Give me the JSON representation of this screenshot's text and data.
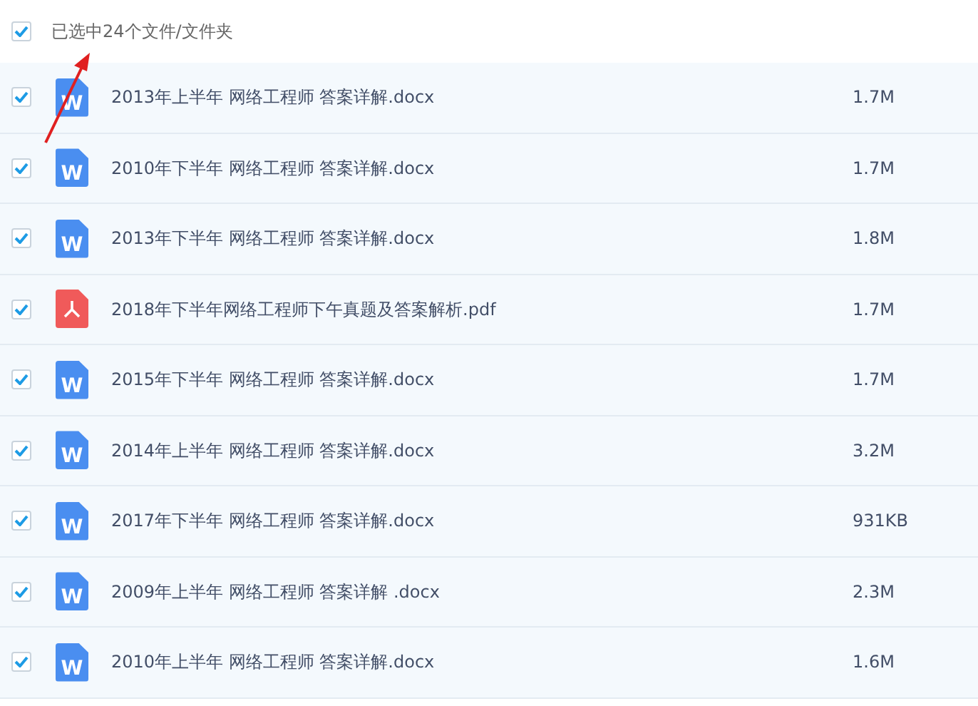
{
  "header": {
    "checked": true,
    "label": "已选中24个文件/文件夹"
  },
  "files": [
    {
      "kind": "word",
      "badge": "W",
      "name": "2013年上半年 网络工程师 答案详解.docx",
      "size": "1.7M",
      "checked": true
    },
    {
      "kind": "word",
      "badge": "W",
      "name": "2010年下半年 网络工程师 答案详解.docx",
      "size": "1.7M",
      "checked": true
    },
    {
      "kind": "word",
      "badge": "W",
      "name": "2013年下半年 网络工程师 答案详解.docx",
      "size": "1.8M",
      "checked": true
    },
    {
      "kind": "pdf",
      "name": "2018年下半年网络工程师下午真题及答案解析.pdf",
      "size": "1.7M",
      "checked": true
    },
    {
      "kind": "word",
      "badge": "W",
      "name": "2015年下半年 网络工程师 答案详解.docx",
      "size": "1.7M",
      "checked": true
    },
    {
      "kind": "word",
      "badge": "W",
      "name": "2014年上半年 网络工程师 答案详解.docx",
      "size": "3.2M",
      "checked": true
    },
    {
      "kind": "word",
      "badge": "W",
      "name": "2017年下半年 网络工程师 答案详解.docx",
      "size": "931KB",
      "checked": true
    },
    {
      "kind": "word",
      "badge": "W",
      "name": "2009年上半年 网络工程师 答案详解 .docx",
      "size": "2.3M",
      "checked": true
    },
    {
      "kind": "word",
      "badge": "W",
      "name": "2010年上半年 网络工程师 答案详解.docx",
      "size": "1.6M",
      "checked": true
    }
  ]
}
